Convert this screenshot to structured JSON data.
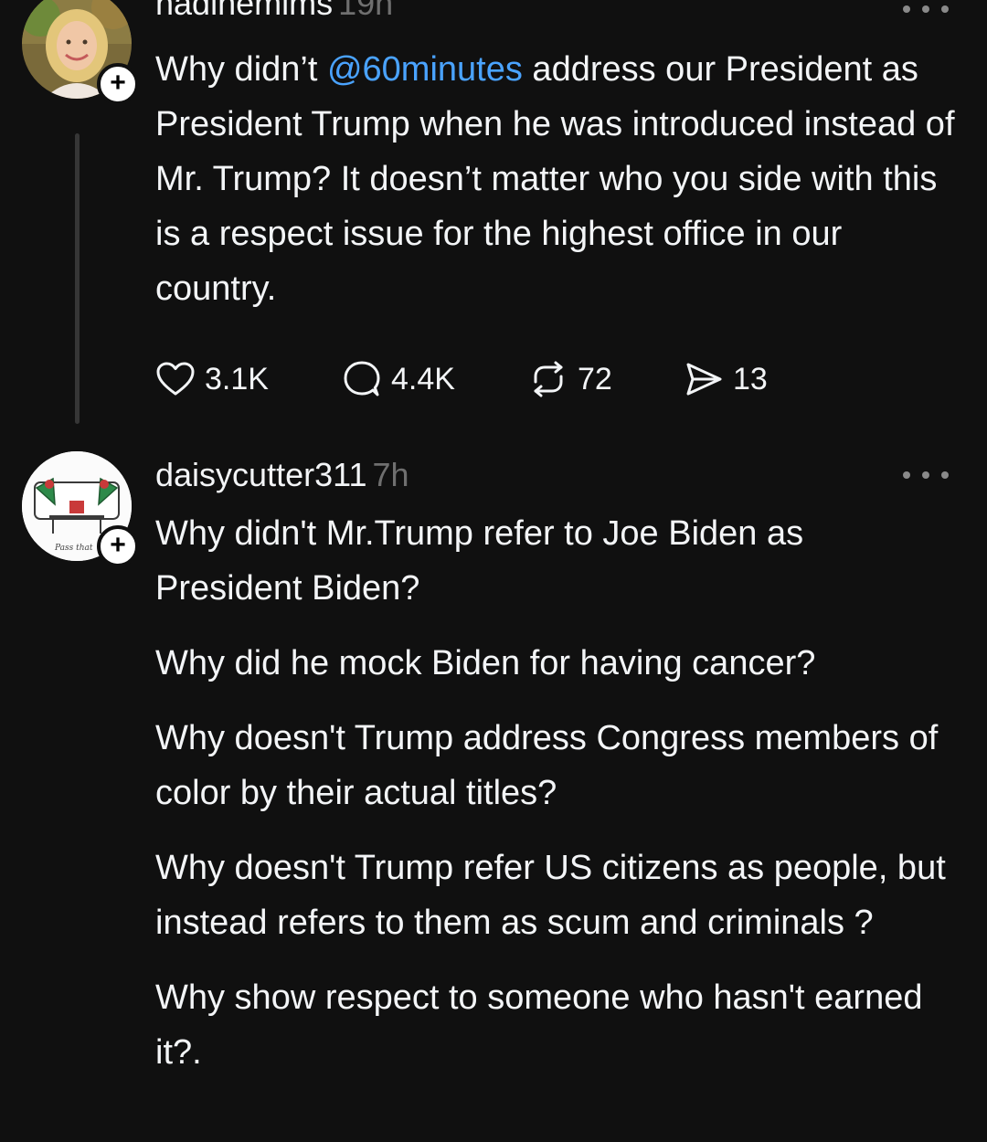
{
  "posts": [
    {
      "username": "nadinemims",
      "time": "19h",
      "text_before_mention": "Why didn’t ",
      "mention": "@60minutes",
      "text_after_mention": " address our President as President Trump when he was introduced instead of Mr. Trump? It doesn’t matter who you side with this is a respect issue for the highest office in our country.",
      "likes": "3.1K",
      "replies": "4.4K",
      "reposts": "72",
      "shares": "13"
    },
    {
      "username": "daisycutter311",
      "time": "7h",
      "paragraphs": [
        "Why didn't Mr.Trump refer to Joe Biden as President Biden?",
        "Why did he mock Biden for having cancer?",
        "Why doesn't Trump address Congress members of color by their actual titles?",
        "Why doesn't Trump refer US citizens as people, but instead refers to them as scum and criminals ?",
        "Why show respect to someone who hasn't earned it?."
      ],
      "avatar_text": "Pass that"
    }
  ],
  "colors": {
    "background": "#101010",
    "text": "#f3f5f7",
    "muted": "#6f6f6f",
    "mention": "#4aa3ff"
  },
  "icons": [
    "plus-icon",
    "more-icon",
    "heart-icon",
    "comment-icon",
    "repost-icon",
    "share-icon"
  ]
}
